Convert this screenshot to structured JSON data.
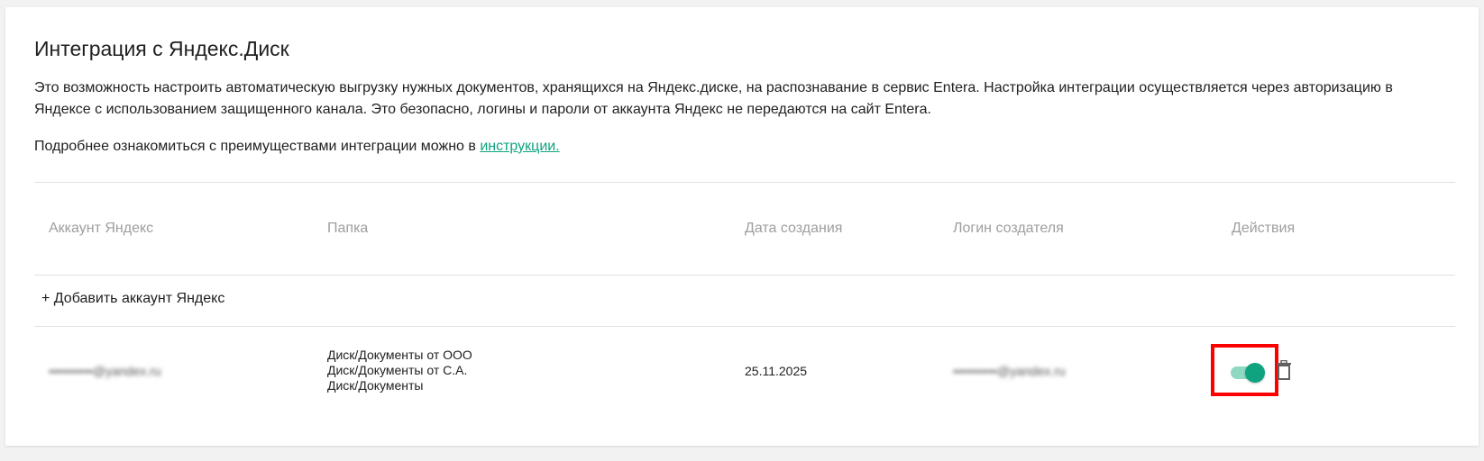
{
  "header": {
    "title": "Интеграция с Яндекс.Диск",
    "description": "Это возможность настроить автоматическую выгрузку нужных документов, хранящихся на Яндекс.диске, на распознавание в сервис Entera. Настройка интеграции осуществляется через авторизацию в Яндексе с использованием защищенного канала. Это безопасно, логины и пароли от аккаунта Яндекс не передаются на сайт Entera.",
    "more_text": "Подробнее ознакомиться с преимуществами интеграции можно в ",
    "more_link": "инструкции."
  },
  "table": {
    "columns": [
      "Аккаунт Яндекс",
      "Папка",
      "Дата создания",
      "Логин создателя",
      "Действия"
    ],
    "add_label": "+ Добавить аккаунт Яндекс",
    "rows": [
      {
        "account": "••••••••••@yandex.ru",
        "folders": [
          "Диск/Документы от ООО",
          "Диск/Документы от С.А.",
          "Диск/Документы"
        ],
        "date": "25.11.2025",
        "creator_login": "••••••••••@yandex.ru",
        "enabled": true
      }
    ]
  },
  "colors": {
    "accent": "#10a37f",
    "toggle_track": "#8fd8c1",
    "highlight": "#ff0000"
  },
  "icons": {
    "delete": "trash-icon"
  }
}
